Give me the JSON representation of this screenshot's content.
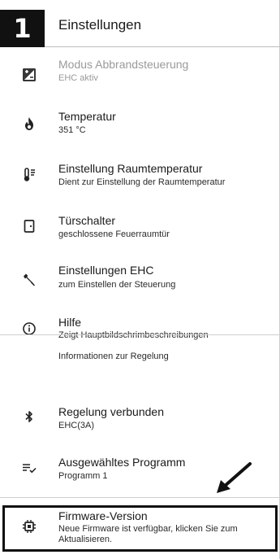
{
  "header": {
    "step_number": "1",
    "title": "Einstellungen"
  },
  "items": [
    {
      "title": "Modus Abbrandsteuerung",
      "subtitle": "EHC aktiv",
      "icon": "mode-icon",
      "disabled": true
    },
    {
      "title": "Temperatur",
      "subtitle": "351 °C",
      "icon": "flame-icon"
    },
    {
      "title": "Einstellung Raumtemperatur",
      "subtitle": "Dient zur Einstellung der Raumtemperatur",
      "icon": "thermometer-icon"
    },
    {
      "title": "Türschalter",
      "subtitle": "geschlossene Feuerraumtür",
      "icon": "door-icon"
    },
    {
      "title": "Einstellungen EHC",
      "subtitle": "zum Einstellen der Steuerung",
      "icon": "wrench-icon"
    },
    {
      "title": "Hilfe",
      "subtitle": "Zeigt Hauptbildschrimbeschreibungen",
      "icon": "info-icon"
    }
  ],
  "section": {
    "label": "Informationen zur Regelung"
  },
  "info_items": [
    {
      "title": "Regelung verbunden",
      "subtitle": "EHC(3A)",
      "icon": "bluetooth-icon"
    },
    {
      "title": "Ausgewähltes Programm",
      "subtitle": "Programm 1",
      "icon": "playlist-check-icon"
    },
    {
      "title": "Firmware-Version",
      "subtitle": "Neue Firmware ist verfügbar, klicken Sie zum Aktualisieren.",
      "icon": "chip-icon"
    }
  ]
}
